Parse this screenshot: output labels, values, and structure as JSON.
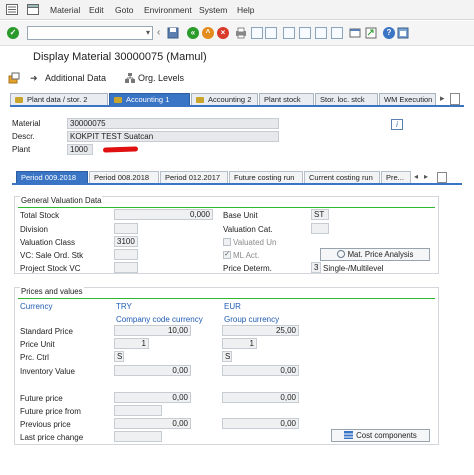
{
  "menu": {
    "items": [
      "Material",
      "Edit",
      "Goto",
      "Environment",
      "System",
      "Help"
    ]
  },
  "title": "Display Material 30000075 (Mamul)",
  "app_toolbar": {
    "additional_data": "Additional Data",
    "org_levels": "Org. Levels"
  },
  "tabs": [
    "Plant data / stor. 2",
    "Accounting 1",
    "Accounting 2",
    "Plant stock",
    "Stor. loc. stck",
    "WM Execution"
  ],
  "header": {
    "material_label": "Material",
    "material_value": "30000075",
    "descr_label": "Descr.",
    "descr_value": "KOKPIT TEST Suatcan",
    "plant_label": "Plant",
    "plant_value": "1000",
    "info_icon": "i"
  },
  "sub_tabs": [
    "Period 009.2018",
    "Period 008.2018",
    "Period 012.2017",
    "Future costing run",
    "Current costing run",
    "Pre..."
  ],
  "general": {
    "title": "General Valuation Data",
    "total_stock_label": "Total Stock",
    "total_stock_value": "0,000",
    "division_label": "Division",
    "valuation_class_label": "Valuation Class",
    "valuation_class_value": "3100",
    "vc_sales_label": "VC: Sale Ord. Stk",
    "project_stock_label": "Project Stock VC",
    "base_unit_label": "Base Unit",
    "base_unit_value": "ST",
    "valuation_cat_label": "Valuation Cat.",
    "valuated_un_label": "Valuated Un",
    "ml_act_label": "ML Act.",
    "ml_act_checked": true,
    "mat_price_analysis": "Mat. Price Analysis",
    "price_determ_label": "Price Determ.",
    "price_determ_value": "3",
    "price_determ_text": "Single-/Multilevel"
  },
  "prices": {
    "title": "Prices and values",
    "currency_label": "Currency",
    "currency_1": "TRY",
    "currency_2": "EUR",
    "company_code_currency": "Company code currency",
    "group_currency": "Group currency",
    "standard_price_label": "Standard Price",
    "standard_price_1": "10,00",
    "standard_price_2": "25,00",
    "price_unit_label": "Price Unit",
    "price_unit_1": "1",
    "price_unit_2": "1",
    "prc_ctrl_label": "Prc. Ctrl",
    "prc_ctrl_1": "S",
    "prc_ctrl_2": "S",
    "inventory_value_label": "Inventory Value",
    "inventory_value_1": "0,00",
    "inventory_value_2": "0,00",
    "future_price_label": "Future price",
    "future_price_1": "0,00",
    "future_price_2": "0,00",
    "future_price_from_label": "Future price from",
    "previous_price_label": "Previous price",
    "previous_price_1": "0,00",
    "previous_price_2": "0,00",
    "last_price_change_label": "Last price change",
    "cost_components": "Cost components"
  },
  "colors": {
    "accent": "#3a74c4",
    "group_line": "#2db82d",
    "currency_blue": "#1f5bb4",
    "redaction": "#e01010"
  }
}
